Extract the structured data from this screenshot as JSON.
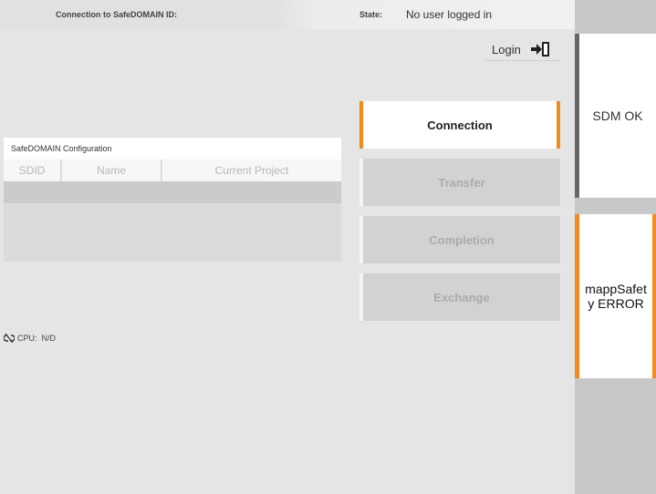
{
  "header": {
    "connection_label": "Connection to SafeDOMAIN ID:",
    "state_label": "State:",
    "state_value": "No user logged in"
  },
  "login": {
    "label": "Login",
    "icon": "login-icon"
  },
  "config": {
    "title": "SafeDOMAIN Configuration",
    "columns": [
      "SDID",
      "Name",
      "Current Project"
    ]
  },
  "cpu": {
    "icon": "broken-link-icon",
    "label": "CPU:",
    "value": "N/D"
  },
  "steps": [
    {
      "label": "Connection",
      "active": true
    },
    {
      "label": "Transfer",
      "active": false
    },
    {
      "label": "Completion",
      "active": false
    },
    {
      "label": "Exchange",
      "active": false
    }
  ],
  "sidebar": {
    "sdm_status": "SDM OK",
    "mapp_status": "mappSafety ERROR"
  },
  "colors": {
    "accent": "#f28a1e",
    "panel": "#e5e5e5",
    "sidebar": "#c8c8c8"
  }
}
